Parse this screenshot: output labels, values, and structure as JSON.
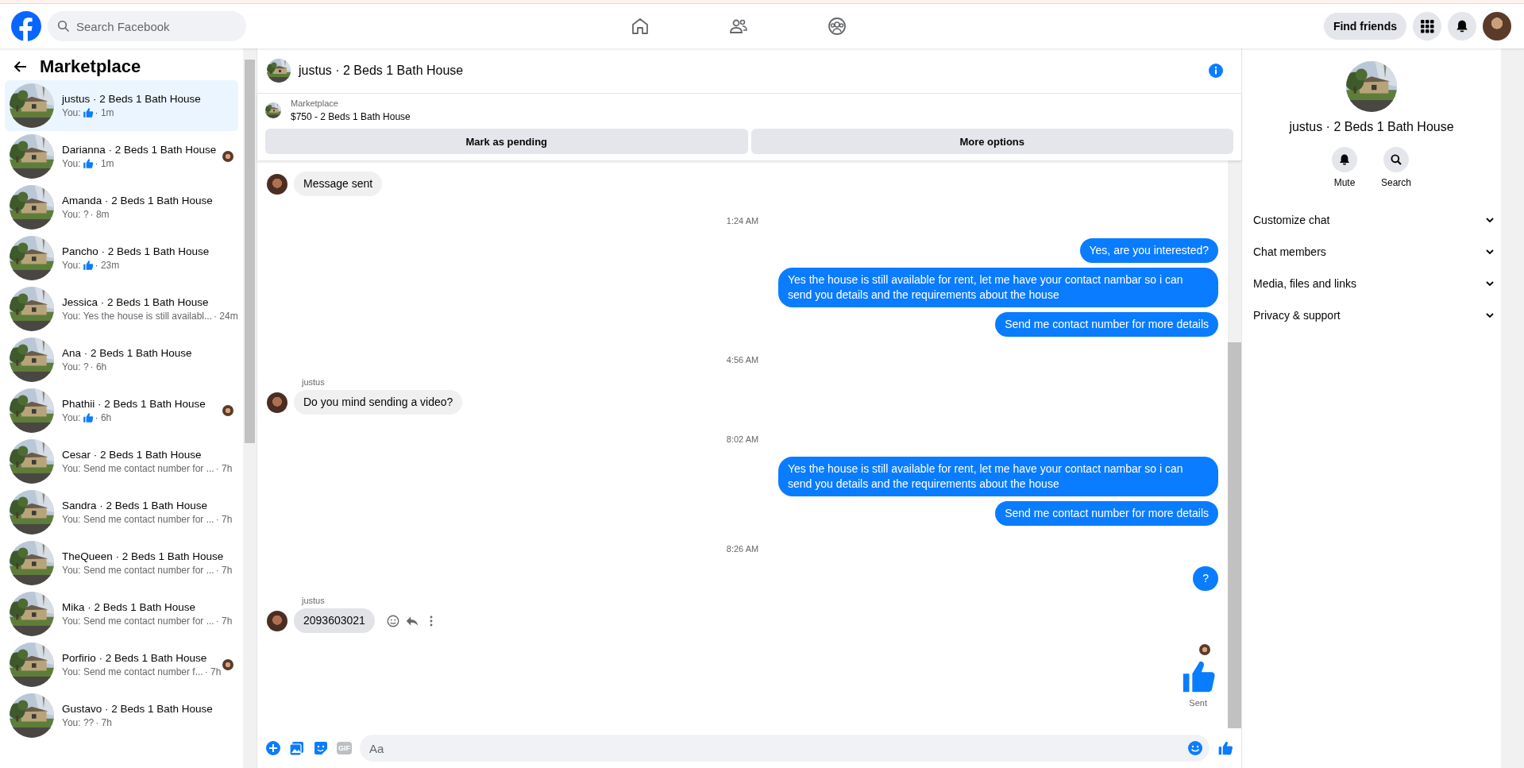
{
  "topbar": {
    "search_placeholder": "Search Facebook",
    "find_friends": "Find friends"
  },
  "sidebar": {
    "title": "Marketplace",
    "conversations": [
      {
        "name": "justus · 2 Beds 1 Bath House",
        "preview": "You:",
        "like": true,
        "time": "· 1m",
        "seen": false,
        "selected": true
      },
      {
        "name": "Darianna · 2 Beds 1 Bath House",
        "preview": "You:",
        "like": true,
        "time": "· 1m",
        "seen": true,
        "selected": false
      },
      {
        "name": "Amanda · 2 Beds 1 Bath House",
        "preview": "You: ?",
        "like": false,
        "time": "· 8m",
        "seen": false,
        "selected": false
      },
      {
        "name": "Pancho · 2 Beds 1 Bath House",
        "preview": "You:",
        "like": true,
        "time": "· 23m",
        "seen": false,
        "selected": false
      },
      {
        "name": "Jessica · 2 Beds 1 Bath House",
        "preview": "You: Yes the house is still availabl...",
        "like": false,
        "time": "· 24m",
        "seen": false,
        "selected": false
      },
      {
        "name": "Ana · 2 Beds 1 Bath House",
        "preview": "You: ?",
        "like": false,
        "time": "· 6h",
        "seen": false,
        "selected": false
      },
      {
        "name": "Phathii · 2 Beds 1 Bath House",
        "preview": "You:",
        "like": true,
        "time": "· 6h",
        "seen": true,
        "selected": false
      },
      {
        "name": "Cesar · 2 Beds 1 Bath House",
        "preview": "You: Send me contact number for ...",
        "like": false,
        "time": "· 7h",
        "seen": false,
        "selected": false
      },
      {
        "name": "Sandra · 2 Beds 1 Bath House",
        "preview": "You: Send me contact number for ...",
        "like": false,
        "time": "· 7h",
        "seen": false,
        "selected": false
      },
      {
        "name": "TheQueen · 2 Beds 1 Bath House",
        "preview": "You: Send me contact number for ...",
        "like": false,
        "time": "· 7h",
        "seen": false,
        "selected": false
      },
      {
        "name": "Mika · 2 Beds 1 Bath House",
        "preview": "You: Send me contact number for ...",
        "like": false,
        "time": "· 7h",
        "seen": false,
        "selected": false
      },
      {
        "name": "Porfirio · 2 Beds 1 Bath House",
        "preview": "You: Send me contact number f...",
        "like": false,
        "time": "· 7h",
        "seen": true,
        "selected": false
      },
      {
        "name": "Gustavo · 2 Beds 1 Bath House",
        "preview": "You: ??",
        "like": false,
        "time": "· 7h",
        "seen": false,
        "selected": false
      }
    ]
  },
  "chat": {
    "title": "justus · 2 Beds 1 Bath House",
    "listing": {
      "label": "Marketplace",
      "title": "$750 - 2 Beds 1 Bath House"
    },
    "actions": [
      "Mark as pending",
      "More options"
    ],
    "messages": [
      {
        "kind": "incoming",
        "text": "Message sent",
        "hovered": false
      },
      {
        "kind": "time",
        "text": "1:24 AM"
      },
      {
        "kind": "outgoing",
        "text": "Yes, are you interested?"
      },
      {
        "kind": "outgoing",
        "text": "Yes the house is still available for rent, let me have your contact nambar so i can send you details and the requirements about the house"
      },
      {
        "kind": "outgoing",
        "text": "Send me contact number for more details"
      },
      {
        "kind": "time",
        "text": "4:56 AM"
      },
      {
        "kind": "incoming",
        "sender": "justus",
        "text": "Do you mind sending a video?",
        "hovered": false
      },
      {
        "kind": "time",
        "text": "8:02 AM"
      },
      {
        "kind": "outgoing",
        "text": "Yes the house is still available for rent, let me have your contact nambar so i can send you details and the requirements about the house"
      },
      {
        "kind": "outgoing",
        "text": "Send me contact number for more details"
      },
      {
        "kind": "time",
        "text": "8:26 AM"
      },
      {
        "kind": "outgoing",
        "text": "?"
      },
      {
        "kind": "incoming",
        "sender": "justus",
        "text": "2093603021",
        "hovered": true
      },
      {
        "kind": "like",
        "status": "Sent"
      }
    ],
    "composer": {
      "gif_label": "GIF",
      "placeholder": "Aa"
    }
  },
  "details": {
    "title": "justus · 2 Beds 1 Bath House",
    "actions": [
      {
        "kind": "mute",
        "label": "Mute"
      },
      {
        "kind": "search",
        "label": "Search"
      }
    ],
    "sections": [
      "Customize chat",
      "Chat members",
      "Media, files and links",
      "Privacy & support"
    ]
  }
}
